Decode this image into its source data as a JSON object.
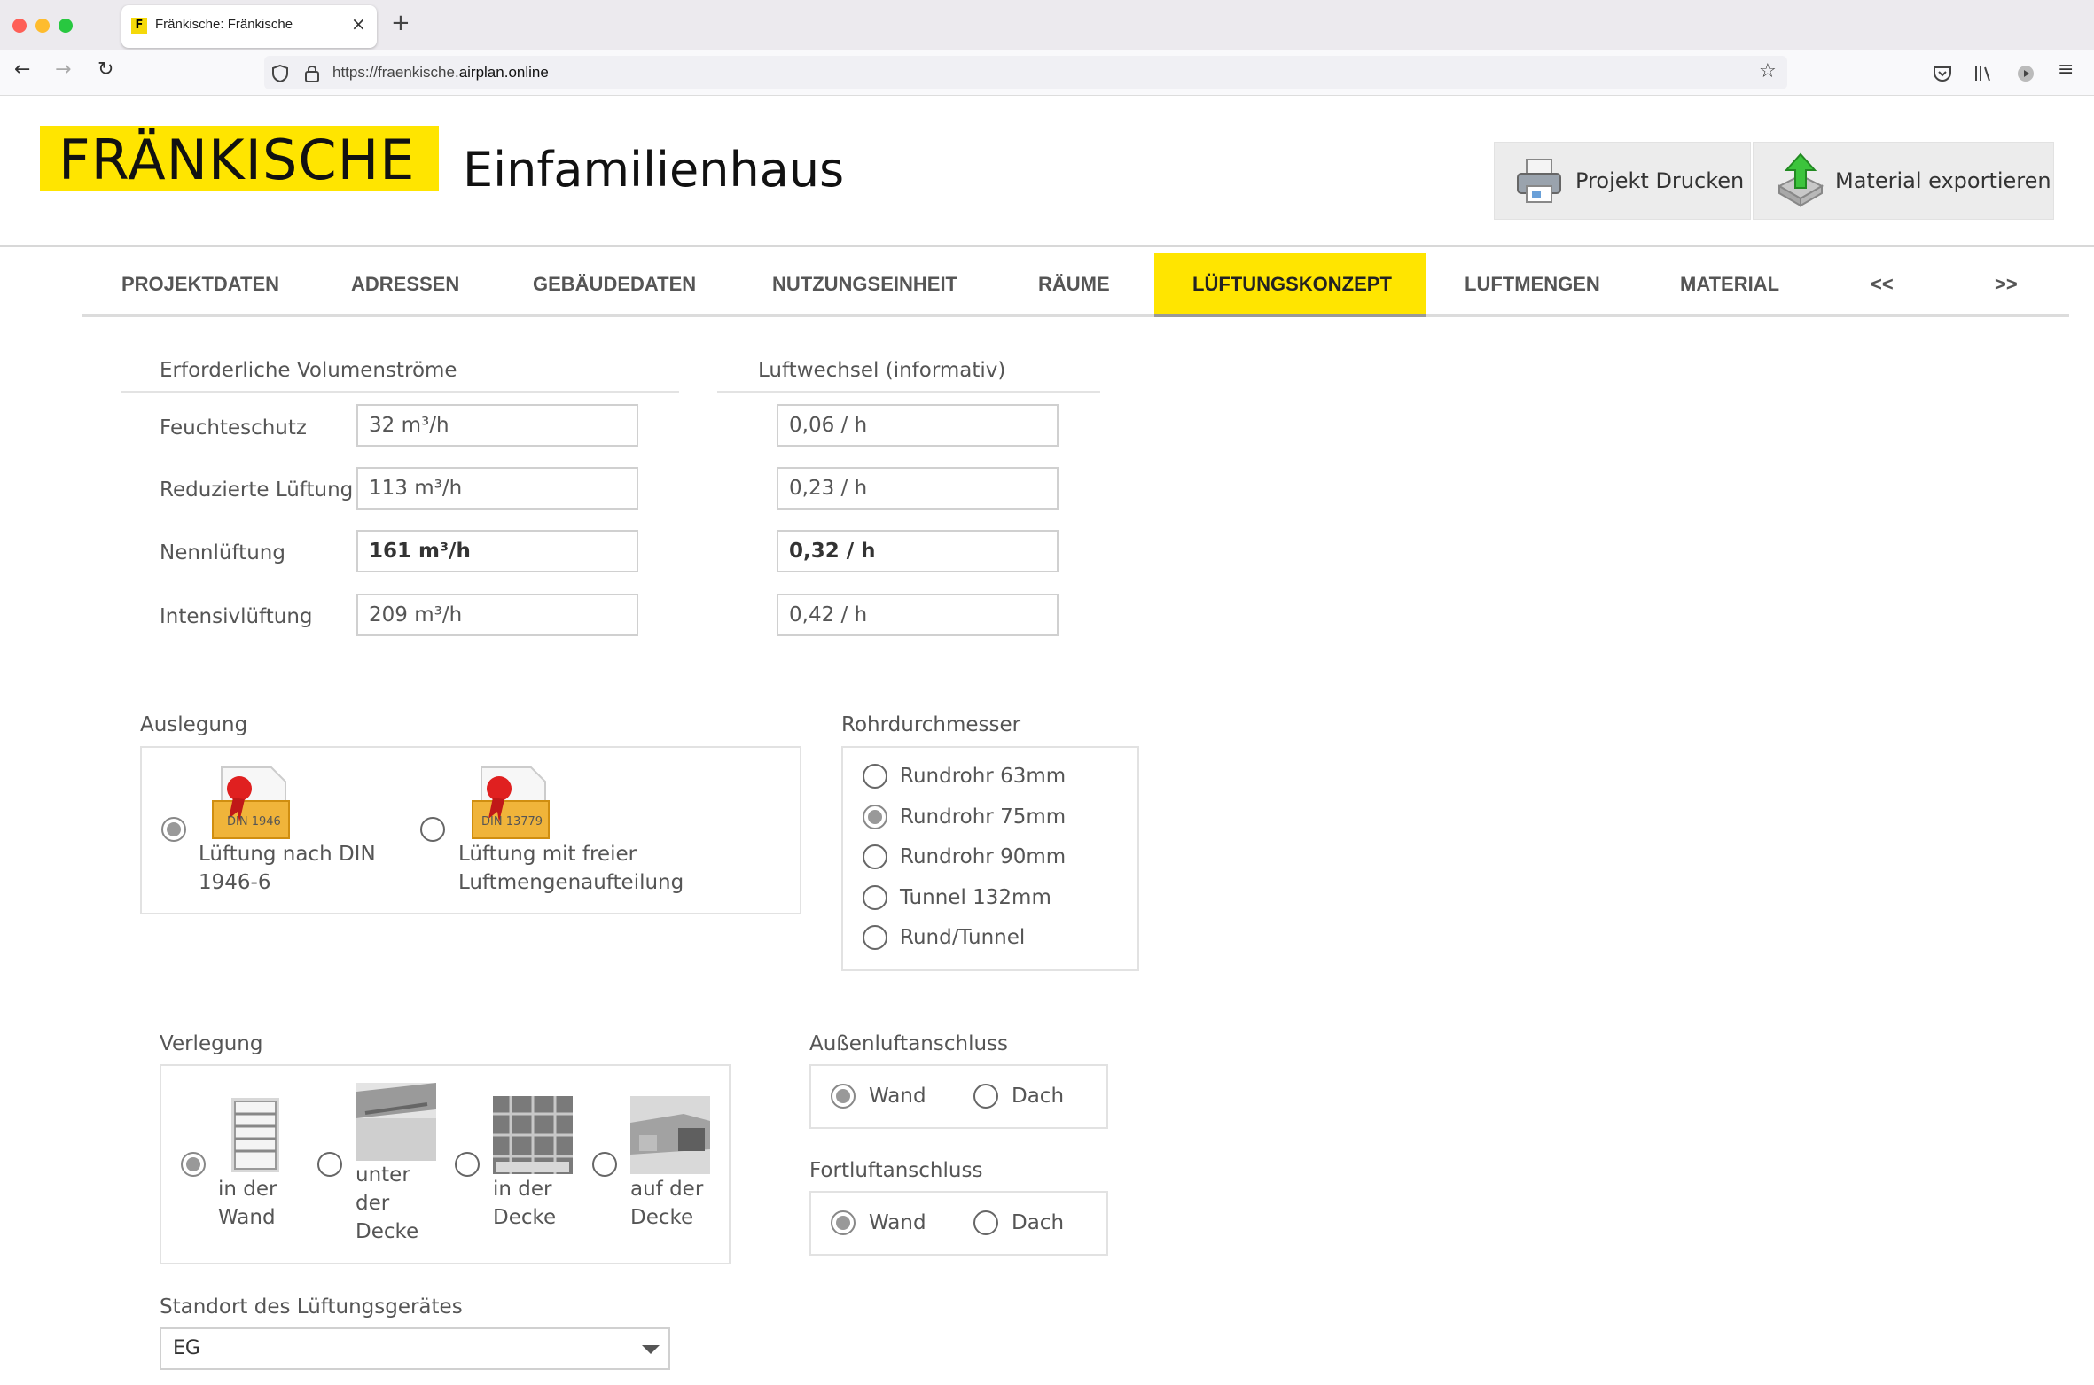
{
  "browser": {
    "tab_title": "Fränkische: Fränkische",
    "favicon_letter": "F",
    "tab_close": "×",
    "new_tab": "+",
    "url_prefix": "https://fraenkische.",
    "url_host": "airplan.online"
  },
  "header": {
    "logo_text": "FRÄNKISCHE",
    "title": "Einfamilienhaus",
    "print_label": "Projekt Drucken",
    "export_label": "Material exportieren"
  },
  "menu": {
    "items": [
      "PROJEKTDATEN",
      "ADRESSEN",
      "GEBÄUDEDATEN",
      "NUTZUNGSEINHEIT",
      "RÄUME",
      "LÜFTUNGSKONZEPT",
      "LUFTMENGEN",
      "MATERIAL",
      "<<",
      ">>"
    ],
    "active": "LÜFTUNGSKONZEPT"
  },
  "volumes": {
    "heading": "Erforderliche Volumenströme",
    "rows": [
      {
        "label": "Feuchteschutz",
        "value": "32 m³/h"
      },
      {
        "label": "Reduzierte Lüftung",
        "value": "113 m³/h"
      },
      {
        "label": "Nennlüftung",
        "value": "161 m³/h"
      },
      {
        "label": "Intensivlüftung",
        "value": "209 m³/h"
      }
    ]
  },
  "airchange": {
    "heading": "Luftwechsel (informativ)",
    "values": [
      "0,06 / h",
      "0,23 / h",
      "0,32 / h",
      "0,42 / h"
    ]
  },
  "auslegung": {
    "heading": "Auslegung",
    "options": [
      {
        "line1": "Lüftung nach DIN",
        "line2": "1946-6",
        "badge": "DIN 1946",
        "checked": true
      },
      {
        "line1": "Lüftung mit freier",
        "line2": "Luftmengenaufteilung",
        "badge": "DIN 13779",
        "checked": false
      }
    ]
  },
  "rohr": {
    "heading": "Rohrdurchmesser",
    "options": [
      "Rundrohr 63mm",
      "Rundrohr 75mm",
      "Rundrohr 90mm",
      "Tunnel 132mm",
      "Rund/Tunnel"
    ],
    "selected": "Rundrohr 75mm"
  },
  "verlegung": {
    "heading": "Verlegung",
    "options": [
      {
        "lines": [
          "in der",
          "Wand"
        ],
        "checked": true
      },
      {
        "lines": [
          "unter",
          "der",
          "Decke"
        ],
        "checked": false
      },
      {
        "lines": [
          "in der",
          "Decke"
        ],
        "checked": false
      },
      {
        "lines": [
          "auf der",
          "Decke"
        ],
        "checked": false
      }
    ]
  },
  "aussenluft": {
    "heading": "Außenluftanschluss",
    "options": [
      "Wand",
      "Dach"
    ],
    "selected": "Wand"
  },
  "fortluft": {
    "heading": "Fortluftanschluss",
    "options": [
      "Wand",
      "Dach"
    ],
    "selected": "Wand"
  },
  "standort": {
    "heading": "Standort des Lüftungsgerätes",
    "value": "EG"
  },
  "colors": {
    "brand_yellow": "#ffe500",
    "text": "#555555",
    "border": "#d0d0d0"
  }
}
